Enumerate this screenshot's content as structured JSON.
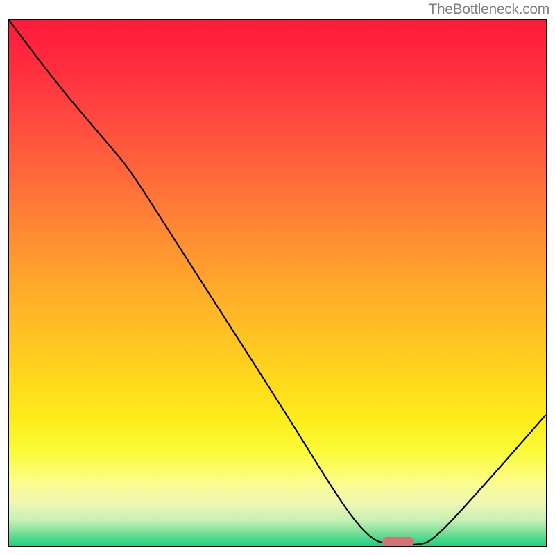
{
  "watermark": "TheBottleneck.com",
  "chart_data": {
    "type": "line",
    "title": "",
    "xlabel": "",
    "ylabel": "",
    "xlim": [
      0,
      100
    ],
    "ylim": [
      0,
      100
    ],
    "curve_points_pct": [
      [
        0,
        100
      ],
      [
        8,
        89
      ],
      [
        18,
        77
      ],
      [
        22,
        72.2
      ],
      [
        26,
        66
      ],
      [
        36,
        50
      ],
      [
        52,
        24.5
      ],
      [
        62,
        8
      ],
      [
        67,
        1.6
      ],
      [
        70.5,
        0.2
      ],
      [
        76,
        0.2
      ],
      [
        79,
        1
      ],
      [
        88,
        11
      ],
      [
        100,
        25
      ]
    ],
    "marker": {
      "x_pct": 72.5,
      "y_pct": 0.8,
      "width_pct": 6.0,
      "color": "#d47277"
    },
    "gradient_stops": [
      {
        "pct": 0,
        "color": "#ff1a3a"
      },
      {
        "pct": 50,
        "color": "#ffb328"
      },
      {
        "pct": 85,
        "color": "#fcfc8e"
      },
      {
        "pct": 100,
        "color": "#1ad080"
      }
    ]
  }
}
